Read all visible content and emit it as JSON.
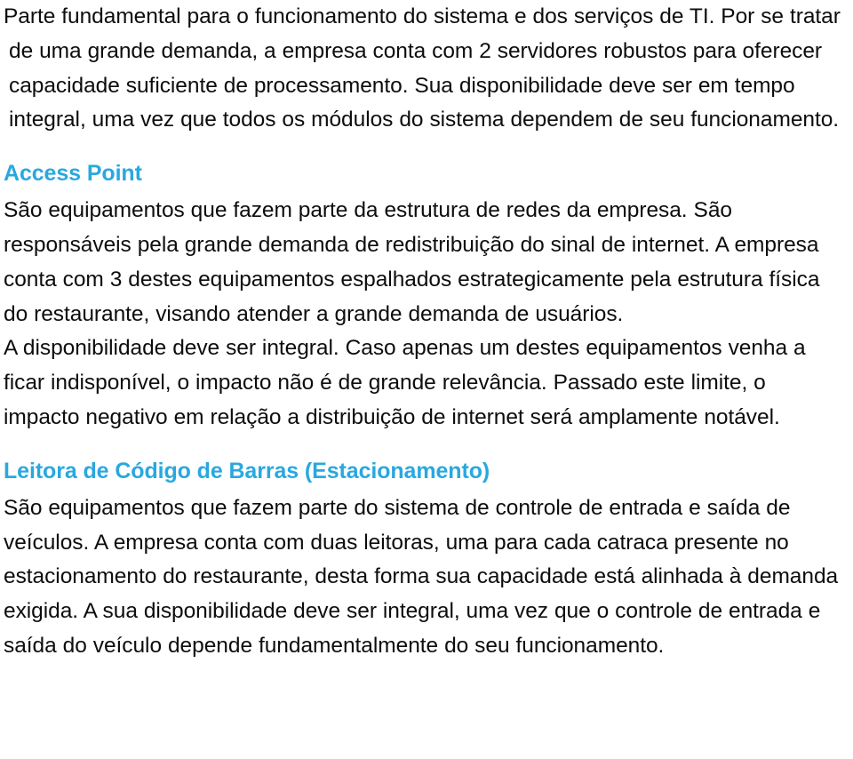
{
  "document": {
    "language": "pt-BR",
    "theme": {
      "body_text_color": "#0d0d0d",
      "heading_color": "#29a8df",
      "page_background": "#ffffff"
    },
    "intro_paragraph": "Parte fundamental para o funcionamento do sistema e dos serviços de TI. Por se tratar de uma grande demanda, a empresa conta com 2 servidores robustos para oferecer capacidade suficiente de processamento. Sua disponibilidade deve ser em tempo integral, uma vez que todos os módulos do sistema dependem de seu funcionamento.",
    "sections": [
      {
        "heading": "Access Point",
        "paragraphs": [
          "São equipamentos que fazem parte da estrutura de redes da empresa. São responsáveis pela grande demanda de redistribuição do sinal de internet. A empresa conta com 3 destes equipamentos espalhados estrategicamente pela estrutura física do restaurante, visando atender a grande demanda de usuários.",
          "A disponibilidade deve ser integral. Caso apenas um destes equipamentos venha a ficar indisponível, o impacto não é de grande relevância. Passado este limite, o impacto negativo em relação a distribuição de internet será amplamente notável."
        ]
      },
      {
        "heading": "Leitora de Código de Barras (Estacionamento)",
        "paragraphs": [
          "São equipamentos que fazem parte do sistema de controle de entrada e saída de veículos. A empresa conta com duas leitoras, uma para cada catraca presente no estacionamento do restaurante, desta forma sua capacidade está alinhada à demanda exigida. A sua disponibilidade deve ser integral, uma vez que o controle de entrada e saída do veículo depende fundamentalmente do seu funcionamento."
        ]
      }
    ]
  }
}
